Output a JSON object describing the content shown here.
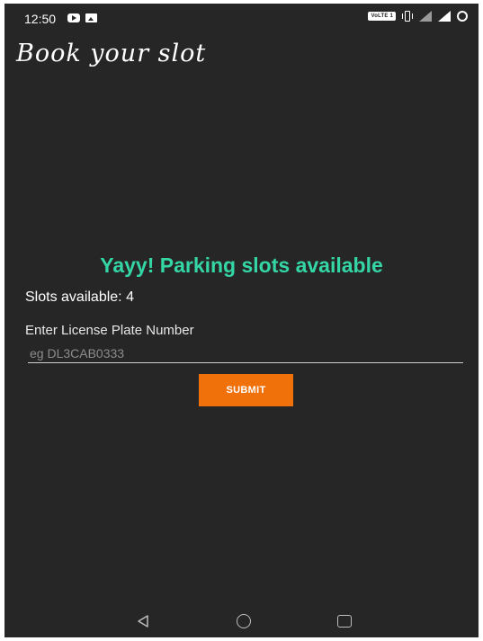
{
  "status_bar": {
    "time": "12:50",
    "network_badge": "VoLTE 1"
  },
  "app": {
    "title": "Book your slot"
  },
  "main": {
    "headline": "Yayy! Parking slots available",
    "slots_text": "Slots available: 4",
    "plate_label": "Enter License Plate Number",
    "plate_input": {
      "value": "",
      "placeholder": "eg DL3CAB0333"
    },
    "submit_label": "SUBMIT"
  },
  "colors": {
    "background": "#262626",
    "headline": "#35d6a6",
    "button": "#f0700a"
  },
  "icons": {
    "status_left": [
      "youtube-icon",
      "gallery-icon"
    ],
    "status_right": [
      "vibrate-icon",
      "signal-icon",
      "signal-icon",
      "battery-icon"
    ],
    "nav": [
      "back-icon",
      "home-icon",
      "recents-icon"
    ]
  }
}
